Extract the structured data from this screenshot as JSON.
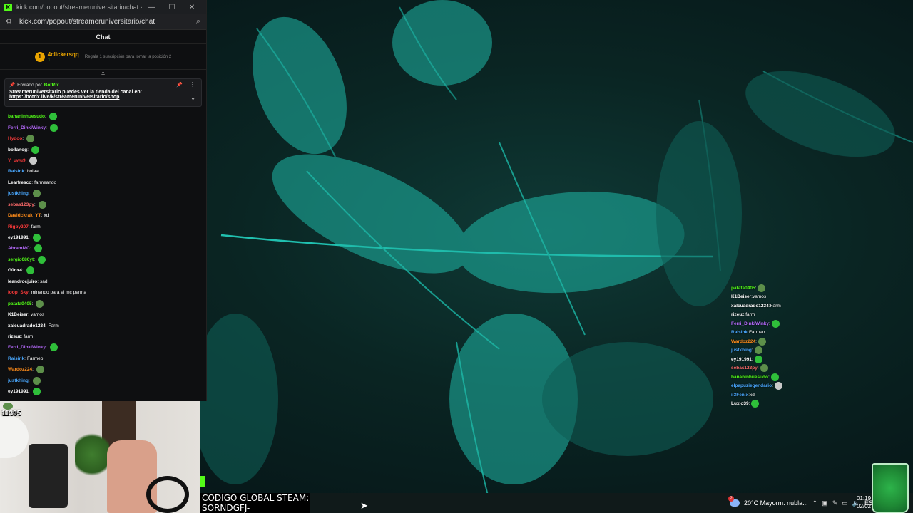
{
  "browser": {
    "window_title": "kick.com/popout/streameruniversitario/chat - G...",
    "url": "kick.com/popout/streameruniversitario/chat",
    "minimize": "—",
    "maximize": "☐",
    "close": "✕"
  },
  "chat": {
    "header": "Chat",
    "leaderboard": {
      "rank": "1",
      "username": "4clickersqq",
      "count": "1",
      "hint": "Regala 1 suscripción para tomar la posición 2"
    },
    "pinned": {
      "sent_by_label": "Enviado por",
      "bot_name": "BotRix",
      "message": "Streameruniversitario puedes ver la tienda del canal en:",
      "link": "https://botrix.live/k/streameruniversitario/shop"
    },
    "messages": [
      {
        "user": "bananinhuesudo",
        "color": "#53fc18",
        "text": "",
        "emote": "green"
      },
      {
        "user": "Ferri_DinkiWinky",
        "color": "#b86bff",
        "text": "",
        "emote": "green"
      },
      {
        "user": "Hydoo",
        "color": "#ff3b3b",
        "text": "",
        "emote": "frog"
      },
      {
        "user": "bollanog",
        "color": "#ffffff",
        "text": "",
        "emote": "green"
      },
      {
        "user": "Y_uwu9",
        "color": "#ff3b3b",
        "text": "",
        "emote": "face"
      },
      {
        "user": "Raisink",
        "color": "#4aa8ff",
        "text": "holaa",
        "emote": ""
      },
      {
        "user": "Learfresco",
        "color": "#ffffff",
        "text": "farmeando",
        "emote": ""
      },
      {
        "user": "justkhing",
        "color": "#4aa8ff",
        "text": "",
        "emote": "frog"
      },
      {
        "user": "sebas123py",
        "color": "#ff6b6b",
        "text": "",
        "emote": "frog"
      },
      {
        "user": "Davidckrak_YT",
        "color": "#ff8c1a",
        "text": "xd",
        "emote": ""
      },
      {
        "user": "Rigby207",
        "color": "#ff3b3b",
        "text": "farm",
        "emote": ""
      },
      {
        "user": "ey191991",
        "color": "#ffffff",
        "text": "",
        "emote": "green"
      },
      {
        "user": "AbramMC",
        "color": "#b86bff",
        "text": "",
        "emote": "green"
      },
      {
        "user": "sergio086yt",
        "color": "#53fc18",
        "text": "",
        "emote": "green"
      },
      {
        "user": "G0nx4",
        "color": "#ffffff",
        "text": "",
        "emote": "green"
      },
      {
        "user": "leandrocjuiro",
        "color": "#ffffff",
        "text": "sad",
        "emote": ""
      },
      {
        "user": "loop_Sky",
        "color": "#ff3b3b",
        "text": "minando para el mc perma",
        "emote": ""
      },
      {
        "user": "patata0405",
        "color": "#53fc18",
        "text": "",
        "emote": "frog"
      },
      {
        "user": "K1Beiser",
        "color": "#ffffff",
        "text": "vamos",
        "emote": ""
      },
      {
        "user": "xalcuadrado1234",
        "color": "#ffffff",
        "text": "Farm",
        "emote": ""
      },
      {
        "user": "rizeuz",
        "color": "#ffffff",
        "text": "farm",
        "emote": ""
      },
      {
        "user": "Ferri_DinkiWinky",
        "color": "#b86bff",
        "text": "",
        "emote": "green"
      },
      {
        "user": "Raisink",
        "color": "#4aa8ff",
        "text": "Farmeo",
        "emote": ""
      },
      {
        "user": "Wardoz224",
        "color": "#ff8c1a",
        "text": "",
        "emote": "frog"
      },
      {
        "user": "justkhing",
        "color": "#4aa8ff",
        "text": "",
        "emote": "frog"
      },
      {
        "user": "ey191991",
        "color": "#ffffff",
        "text": "",
        "emote": "green"
      }
    ]
  },
  "webcam": {
    "overlay_number": "11395"
  },
  "overlay_chat": {
    "messages": [
      {
        "user": "patata0405",
        "color": "#53fc18",
        "text": "",
        "emote": "frog"
      },
      {
        "user": "K1Beiser",
        "color": "#ffffff",
        "text": "vamos",
        "emote": ""
      },
      {
        "user": "xalcuadrado1234",
        "color": "#ffffff",
        "text": "Farm",
        "emote": ""
      },
      {
        "user": "rizeuz",
        "color": "#ffffff",
        "text": "farm",
        "emote": ""
      },
      {
        "user": "Ferri_DinkiWinky",
        "color": "#b86bff",
        "text": "",
        "emote": "green"
      },
      {
        "user": "Raisink",
        "color": "#4aa8ff",
        "text": "Farmeo",
        "emote": ""
      },
      {
        "user": "Wardoz224",
        "color": "#ff8c1a",
        "text": "",
        "emote": "frog"
      },
      {
        "user": "justkhing",
        "color": "#4aa8ff",
        "text": "",
        "emote": "frog"
      },
      {
        "user": "ey191991",
        "color": "#ffffff",
        "text": "",
        "emote": "green"
      },
      {
        "user": "sebas123py",
        "color": "#ff6b6b",
        "text": "",
        "emote": "frog"
      },
      {
        "user": "bananinhuesudo",
        "color": "#53fc18",
        "text": "",
        "emote": "green"
      },
      {
        "user": "elpapuziegendario",
        "color": "#4aa8ff",
        "text": "",
        "emote": "face"
      },
      {
        "user": "il3Fenix",
        "color": "#4aa8ff",
        "text": "xd",
        "emote": ""
      },
      {
        "user": "Luxlo39",
        "color": "#ffffff",
        "text": "",
        "emote": "green"
      }
    ]
  },
  "stream_overlay": {
    "steam_code_line1": "CODIGO GLOBAL STEAM:",
    "steam_code_line2": "SORNDGFJ-"
  },
  "taskbar": {
    "notification_count": "2",
    "weather": "20°C  Mayorm. nubla...",
    "language": "ESP",
    "time": "01:19",
    "date": "02/02"
  }
}
